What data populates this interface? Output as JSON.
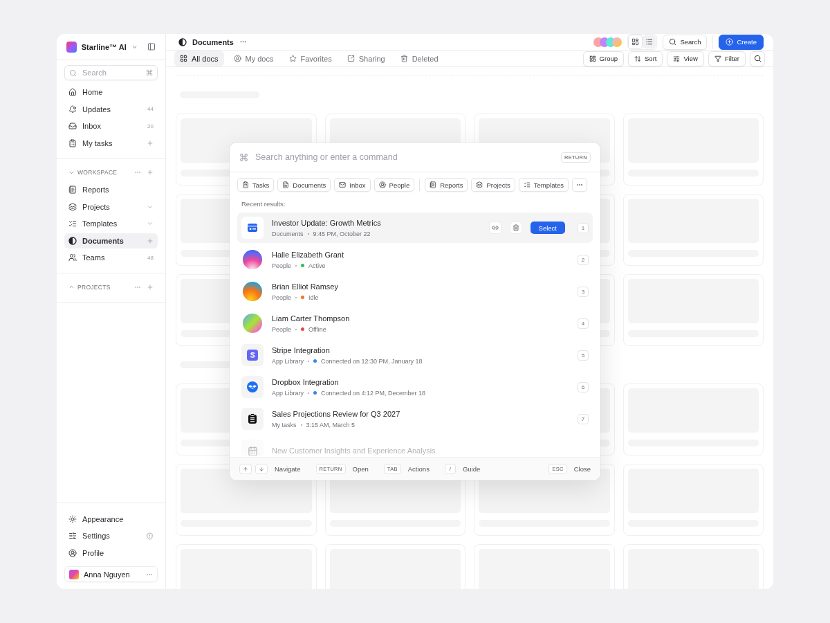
{
  "workspace": {
    "name": "Starline™ AI"
  },
  "sidebar": {
    "search": {
      "placeholder": "Search"
    },
    "items": [
      {
        "label": "Home",
        "selected": false
      },
      {
        "label": "Updates",
        "count": "44",
        "selected": false
      },
      {
        "label": "Inbox",
        "count": "20",
        "selected": false
      },
      {
        "label": "My tasks",
        "selected": false
      }
    ],
    "sections": [
      {
        "title": "WORKSPACE",
        "expanded": true,
        "items": [
          {
            "label": "Reports",
            "selected": false
          },
          {
            "label": "Projects",
            "selected": false
          },
          {
            "label": "Templates",
            "selected": false
          },
          {
            "label": "Documents",
            "selected": true
          },
          {
            "label": "Teams",
            "count": "48",
            "selected": false
          }
        ]
      },
      {
        "title": "PROJECTS",
        "expanded": false
      }
    ],
    "footer_items": [
      {
        "label": "Appearance"
      },
      {
        "label": "Settings"
      },
      {
        "label": "Profile"
      }
    ],
    "user": {
      "name": "Anna Nguyen"
    }
  },
  "header": {
    "title": "Documents",
    "view_toggle": [
      {
        "selected": true
      },
      {
        "selected": false
      }
    ],
    "search_label": "Search",
    "create_label": "Create"
  },
  "tabs": [
    {
      "label": "All docs",
      "selected": true
    },
    {
      "label": "My docs",
      "selected": false
    },
    {
      "label": "Favorites",
      "selected": false
    },
    {
      "label": "Sharing",
      "selected": false
    },
    {
      "label": "Deleted",
      "selected": false
    }
  ],
  "actions": [
    "Group",
    "Sort",
    "View",
    "Filter"
  ],
  "palette": {
    "placeholder": "Search anything or enter a command",
    "submit_key": "RETURN",
    "chip_groups": [
      [
        "Tasks",
        "Documents",
        "Inbox",
        "People"
      ],
      [
        "Reports",
        "Projects",
        "Templates"
      ]
    ],
    "recent_label": "Recent results:",
    "results": [
      {
        "kind": "document",
        "title": "Investor Update: Growth Metrics",
        "source": "Documents",
        "detail": "9:45 PM, October 22",
        "number": "1",
        "selected": true,
        "faded": false,
        "select_label": "Select"
      },
      {
        "kind": "person",
        "title": "Halle Elizabeth Grant",
        "source": "People",
        "detail": "Active",
        "color": "#22c55e",
        "number": "2",
        "selected": false,
        "faded": false
      },
      {
        "kind": "person",
        "title": "Brian Elliot Ramsey",
        "source": "People",
        "detail": "Idle",
        "color": "#f97316",
        "number": "3",
        "selected": false,
        "faded": false
      },
      {
        "kind": "person",
        "title": "Liam Carter Thompson",
        "source": "People",
        "detail": "Offline",
        "color": "#ef4444",
        "number": "4",
        "selected": false,
        "faded": false
      },
      {
        "kind": "stripe",
        "title": "Stripe Integration",
        "source": "App Library",
        "detail": "Connected on 12:30 PM, January 18",
        "color": "#3b82f6",
        "number": "5",
        "selected": false,
        "faded": false
      },
      {
        "kind": "dropbox",
        "title": "Dropbox Integration",
        "source": "App Library",
        "detail": "Connected on 4:12 PM, December 18",
        "color": "#3b82f6",
        "number": "6",
        "selected": false,
        "faded": false
      },
      {
        "kind": "task",
        "title": "Sales Projections Review for Q3 2027",
        "source": "My tasks",
        "detail": "3:15 AM, March 5",
        "number": "7",
        "selected": false,
        "faded": false
      },
      {
        "kind": "calendar",
        "title": "New Customer Insights and Experience Analysis",
        "selected": false,
        "faded": true
      }
    ],
    "footer": {
      "hints": [
        {
          "kind": "arrows",
          "label": "Navigate"
        },
        {
          "kind": "key",
          "key": "RETURN",
          "label": "Open"
        },
        {
          "kind": "key",
          "key": "TAB",
          "label": "Actions"
        },
        {
          "kind": "key",
          "key": "/",
          "label": "Guide"
        }
      ],
      "close": {
        "key": "ESC",
        "label": "Close"
      }
    }
  }
}
